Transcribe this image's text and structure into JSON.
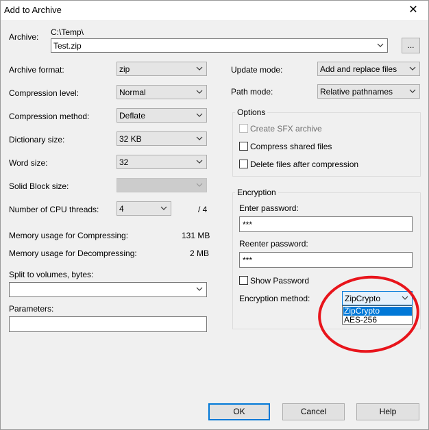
{
  "window": {
    "title": "Add to Archive",
    "close_glyph": "✕"
  },
  "archive": {
    "label": "Archive:",
    "path": "C:\\Temp\\",
    "filename": "Test.zip",
    "browse_label": "..."
  },
  "left": {
    "format_label": "Archive format:",
    "format_value": "zip",
    "level_label": "Compression level:",
    "level_value": "Normal",
    "method_label": "Compression method:",
    "method_value": "Deflate",
    "dict_label": "Dictionary size:",
    "dict_value": "32 KB",
    "word_label": "Word size:",
    "word_value": "32",
    "solid_label": "Solid Block size:",
    "solid_value": "",
    "threads_label": "Number of CPU threads:",
    "threads_value": "4",
    "threads_max": "/ 4",
    "mem_comp_label": "Memory usage for Compressing:",
    "mem_comp_value": "131 MB",
    "mem_decomp_label": "Memory usage for Decompressing:",
    "mem_decomp_value": "2 MB",
    "split_label": "Split to volumes, bytes:",
    "split_value": "",
    "params_label": "Parameters:",
    "params_value": ""
  },
  "right": {
    "update_label": "Update mode:",
    "update_value": "Add and replace files",
    "pathmode_label": "Path mode:",
    "pathmode_value": "Relative pathnames",
    "options_title": "Options",
    "sfx_label": "Create SFX archive",
    "shared_label": "Compress shared files",
    "delete_label": "Delete files after compression",
    "enc_title": "Encryption",
    "enter_pw_label": "Enter password:",
    "enter_pw_value": "***",
    "reenter_pw_label": "Reenter password:",
    "reenter_pw_value": "***",
    "show_pw_label": "Show Password",
    "enc_method_label": "Encryption method:",
    "enc_method_value": "ZipCrypto",
    "enc_options": [
      "ZipCrypto",
      "AES-256"
    ]
  },
  "buttons": {
    "ok": "OK",
    "cancel": "Cancel",
    "help": "Help"
  },
  "colors": {
    "accent": "#0078d7",
    "annotation": "#e8141b"
  }
}
